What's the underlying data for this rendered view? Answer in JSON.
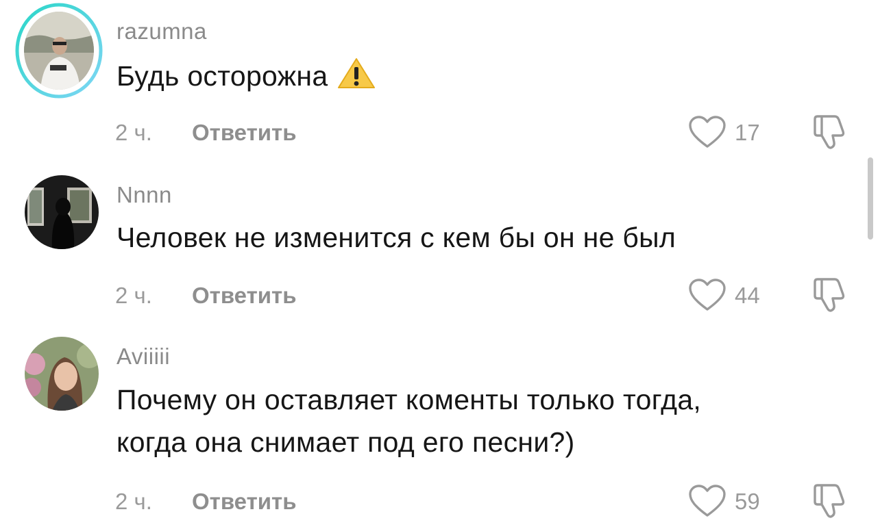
{
  "comments": [
    {
      "username": "razumna",
      "text": "Будь осторожна",
      "emoji": "warning-sign",
      "time": "2 ч.",
      "reply_label": "Ответить",
      "likes": "17",
      "avatar": "user-avatar",
      "has_story_ring": true
    },
    {
      "username": "Nnnn",
      "text": "Человек не изменится с кем бы он не был",
      "time": "2 ч.",
      "reply_label": "Ответить",
      "likes": "44",
      "avatar": "user-avatar"
    },
    {
      "username": "Aviiiii",
      "text_line1": "Почему он оставляет коменты только тогда,",
      "text_line2": "когда она снимает под его песни?)",
      "time": "2 ч.",
      "reply_label": "Ответить",
      "likes": "59",
      "avatar": "user-avatar"
    }
  ],
  "icons": {
    "like": "heart-outline-icon",
    "dislike": "thumbs-down-icon"
  },
  "colors": {
    "story_ring_start": "#2ad6c8",
    "story_ring_end": "#6fd6f0",
    "username": "#8a8a8a",
    "text": "#161616",
    "meta": "#9a9a9a"
  }
}
